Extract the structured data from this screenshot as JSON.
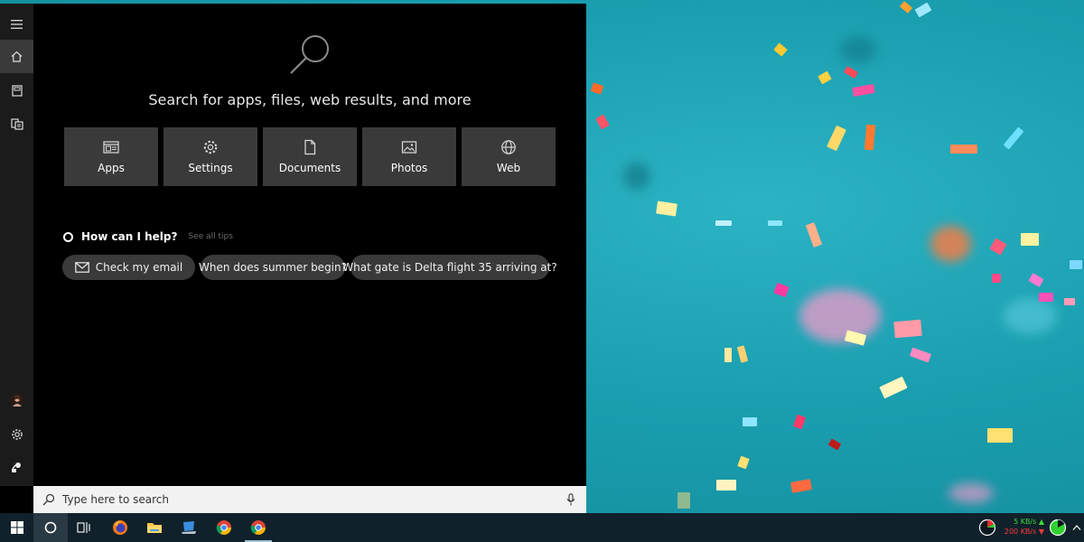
{
  "search_panel": {
    "headline": "Search for apps, files, web results, and more",
    "tiles": [
      {
        "label": "Apps",
        "icon": "apps-icon"
      },
      {
        "label": "Settings",
        "icon": "gear-icon"
      },
      {
        "label": "Documents",
        "icon": "document-icon"
      },
      {
        "label": "Photos",
        "icon": "photo-icon"
      },
      {
        "label": "Web",
        "icon": "globe-icon"
      }
    ],
    "help": {
      "title": "How can I help?",
      "tips_link": "See all tips"
    },
    "suggestions": [
      "Check my email",
      "When does summer begin?",
      "What gate is Delta flight 35 arriving at?"
    ],
    "search_box": {
      "placeholder": "Type here to search"
    }
  },
  "left_rail": {
    "items": [
      "hamburger-menu-icon",
      "home-icon",
      "notebook-icon",
      "devices-icon",
      "avatar",
      "gear-icon",
      "feedback-icon"
    ]
  },
  "taskbar": {
    "apps": [
      "start-windows-icon",
      "cortana-icon",
      "task-view-icon",
      "firefox-icon",
      "file-explorer-icon",
      "laptop-app-icon",
      "chrome-icon",
      "chrome-icon"
    ],
    "network": {
      "upload": "5 KB/s",
      "download": "200 KB/s"
    }
  },
  "colors": {
    "panel_bg": "#000000",
    "tile_bg": "#3a3a3a",
    "rail_bg": "#1b1b1b",
    "taskbar_bg": "#10212b",
    "wallpaper": "#1fa3b3"
  }
}
